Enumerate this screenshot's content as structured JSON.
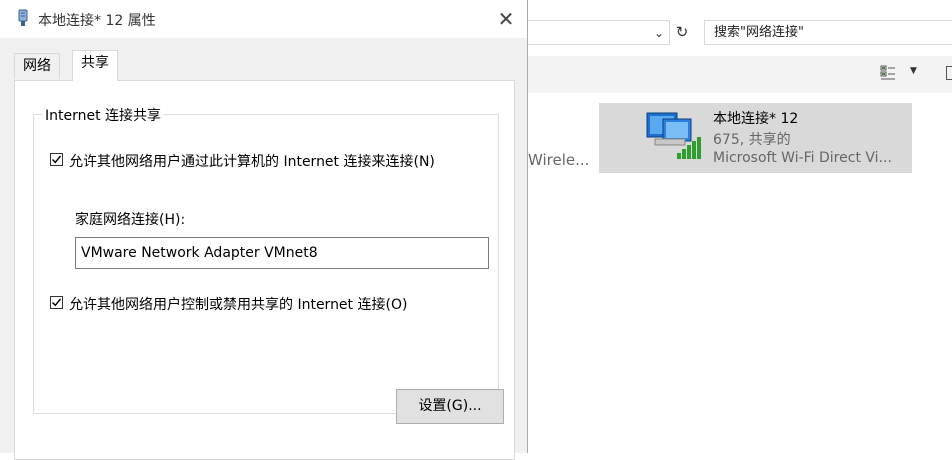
{
  "explorer": {
    "search_placeholder": "搜索\"网络连接\"",
    "partial_item_label": "Wirele...",
    "connection": {
      "name": "本地连接* 12",
      "status": "675, 共享的",
      "device": "Microsoft Wi-Fi Direct Vi..."
    },
    "icons": {
      "refresh": "refresh-icon",
      "view": "change-view-icon",
      "network": "network-adapter-icon"
    }
  },
  "dialog": {
    "title": "本地连接* 12 属性",
    "close_glyph": "✕",
    "tabs": [
      {
        "label": "网络",
        "active": false
      },
      {
        "label": "共享",
        "active": true
      }
    ],
    "group_title": "Internet 连接共享",
    "allow_connect": {
      "label": "允许其他网络用户通过此计算机的 Internet 连接来连接(N)",
      "checked": true
    },
    "home_network_label": "家庭网络连接(H):",
    "home_network_value": "VMware Network Adapter VMnet8",
    "allow_control": {
      "label": "允许其他网络用户控制或禁用共享的 Internet 连接(O)",
      "checked": true
    },
    "settings_button": "设置(G)..."
  },
  "colors": {
    "dialog_bg": "#f0f0f0",
    "selection_bg": "#d9d9d9",
    "signal_green": "#2e9e2e"
  }
}
